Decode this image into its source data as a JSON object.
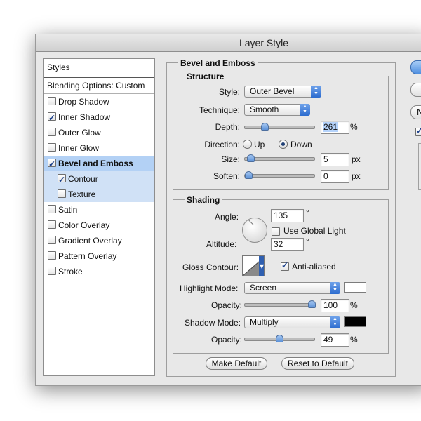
{
  "window": {
    "title": "Layer Style"
  },
  "styles_panel": {
    "header": "Styles",
    "blending": "Blending Options: Custom",
    "items": [
      {
        "label": "Drop Shadow",
        "checked": false
      },
      {
        "label": "Inner Shadow",
        "checked": true
      },
      {
        "label": "Outer Glow",
        "checked": false
      },
      {
        "label": "Inner Glow",
        "checked": false
      },
      {
        "label": "Bevel and Emboss",
        "checked": true,
        "selected": true
      },
      {
        "label": "Contour",
        "checked": true,
        "sub": true
      },
      {
        "label": "Texture",
        "checked": false,
        "sub": true
      },
      {
        "label": "Satin",
        "checked": false
      },
      {
        "label": "Color Overlay",
        "checked": false
      },
      {
        "label": "Gradient Overlay",
        "checked": false
      },
      {
        "label": "Pattern Overlay",
        "checked": false
      },
      {
        "label": "Stroke",
        "checked": false
      }
    ]
  },
  "bevel": {
    "group_label": "Bevel and Emboss",
    "structure": {
      "label": "Structure",
      "style_label": "Style:",
      "style_value": "Outer Bevel",
      "technique_label": "Technique:",
      "technique_value": "Smooth",
      "depth_label": "Depth:",
      "depth_value": "261",
      "depth_unit": "%",
      "depth_slider": 0.26,
      "direction_label": "Direction:",
      "direction_up": "Up",
      "direction_down": "Down",
      "direction_selected": "Down",
      "size_label": "Size:",
      "size_value": "5",
      "size_unit": "px",
      "size_slider": 0.03,
      "soften_label": "Soften:",
      "soften_value": "0",
      "soften_unit": "px",
      "soften_slider": 0.0
    },
    "shading": {
      "label": "Shading",
      "angle_label": "Angle:",
      "angle_value": "135",
      "angle_unit": "°",
      "global_light_label": "Use Global Light",
      "global_light_checked": false,
      "altitude_label": "Altitude:",
      "altitude_value": "32",
      "altitude_unit": "°",
      "gloss_label": "Gloss Contour:",
      "anti_aliased_label": "Anti-aliased",
      "anti_aliased_checked": true,
      "highlight_label": "Highlight Mode:",
      "highlight_value": "Screen",
      "highlight_color": "#ffffff",
      "highlight_opacity_label": "Opacity:",
      "highlight_opacity_value": "100",
      "highlight_opacity_unit": "%",
      "highlight_opacity_slider": 1.0,
      "shadow_label": "Shadow Mode:",
      "shadow_value": "Multiply",
      "shadow_color": "#000000",
      "shadow_opacity_label": "Opacity:",
      "shadow_opacity_value": "49",
      "shadow_opacity_unit": "%",
      "shadow_opacity_slider": 0.49
    },
    "make_default": "Make Default",
    "reset_default": "Reset to Default"
  },
  "side": {
    "n_label": "N"
  }
}
